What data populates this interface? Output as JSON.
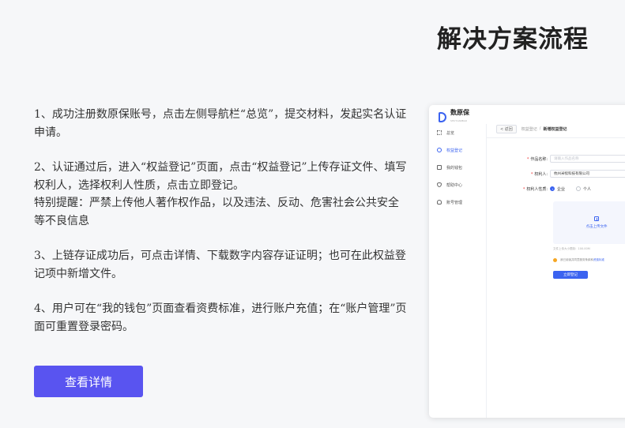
{
  "title": "解决方案流程",
  "steps": [
    {
      "lines": [
        "1、成功注册数原保账号，点击左侧导航栏“总览”，提交材料，发起实名认证申请。"
      ]
    },
    {
      "lines": [
        "2、认证通过后，进入“权益登记”页面，点击“权益登记”上传存证文件、填写权利人，选择权利人性质，点击立即登记。",
        "特别提醒：严禁上传他人著作权作品，以及违法、反动、危害社会公共安全等不良信息"
      ]
    },
    {
      "lines": [
        "3、上链存证成功后，可点击详情、下载数字内容存证证明；也可在此权益登记项中新增文件。"
      ]
    },
    {
      "lines": [
        "4、用户可在“我的钱包”页面查看资费标准，进行账户充值；在“账户管理”页面可重置登录密码。"
      ]
    }
  ],
  "cta_label": "查看详情",
  "mockup": {
    "brand": {
      "name": "数原保",
      "sub": "SHUYUANBAO"
    },
    "nav": [
      {
        "label": "总览",
        "icon": "grid-icon",
        "active": false
      },
      {
        "label": "权益登记",
        "icon": "circle-icon",
        "active": true
      },
      {
        "label": "我的钱包",
        "icon": "wallet-icon",
        "active": false
      },
      {
        "label": "帮助中心",
        "icon": "shield-icon",
        "active": false
      },
      {
        "label": "账号管理",
        "icon": "user-icon",
        "active": false
      }
    ],
    "topbar": {
      "back": "< 返回",
      "crumb_parent": "权益登记",
      "crumb_sep": "/",
      "crumb_current": "新增权益登记"
    },
    "form": {
      "work_name_label": "作品名称:",
      "work_name_placeholder": "请输入作品名称",
      "owner_label": "权利人:",
      "owner_value": "杭州米犊科技有限公司",
      "nature_label": "权利人性质:",
      "nature_options": [
        "企业",
        "个人"
      ],
      "upload_text": "点击上传文件",
      "hint": "文件上传大小限制：100.00M",
      "notice": "我已阅读并同意服务条款和",
      "notice_link": "资费标准",
      "submit": "立即登记"
    }
  },
  "colors": {
    "accent": "#5954f0",
    "mock_accent": "#3b63f0"
  }
}
